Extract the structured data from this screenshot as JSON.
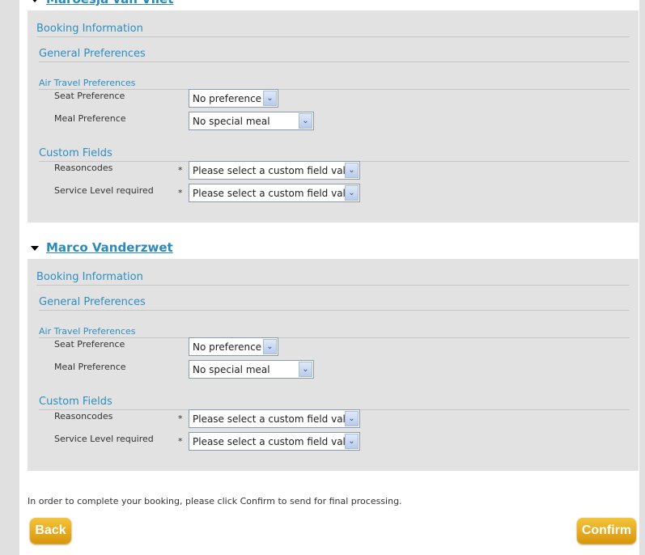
{
  "travelers": [
    {
      "name": "Maroesja van Vliet",
      "booking_information": "Booking Information",
      "general_preferences": "General Preferences",
      "air_travel_preferences": "Air Travel Preferences",
      "seat_label": "Seat Preference",
      "seat_value": "No preference",
      "meal_label": "Meal Preference",
      "meal_value": "No special meal",
      "custom_fields": "Custom Fields",
      "reasoncodes_label": "Reasoncodes",
      "reasoncodes_value": "Please select a custom field value",
      "service_label": "Service Level required",
      "service_value": "Please select a custom field value",
      "required_marker": "*"
    },
    {
      "name": "Marco Vanderzwet",
      "booking_information": "Booking Information",
      "general_preferences": "General Preferences",
      "air_travel_preferences": "Air Travel Preferences",
      "seat_label": "Seat Preference",
      "seat_value": "No preference",
      "meal_label": "Meal Preference",
      "meal_value": "No special meal",
      "custom_fields": "Custom Fields",
      "reasoncodes_label": "Reasoncodes",
      "reasoncodes_value": "Please select a custom field value",
      "service_label": "Service Level required",
      "service_value": "Please select a custom field value",
      "required_marker": "*"
    }
  ],
  "footer": {
    "note": "In order to complete your booking, please click Confirm to send for final processing.",
    "back_label": "Back",
    "confirm_label": "Confirm"
  },
  "colors": {
    "heading": "#2e8ec0",
    "button": "#e0a418",
    "panel": "#e2e2e2"
  }
}
